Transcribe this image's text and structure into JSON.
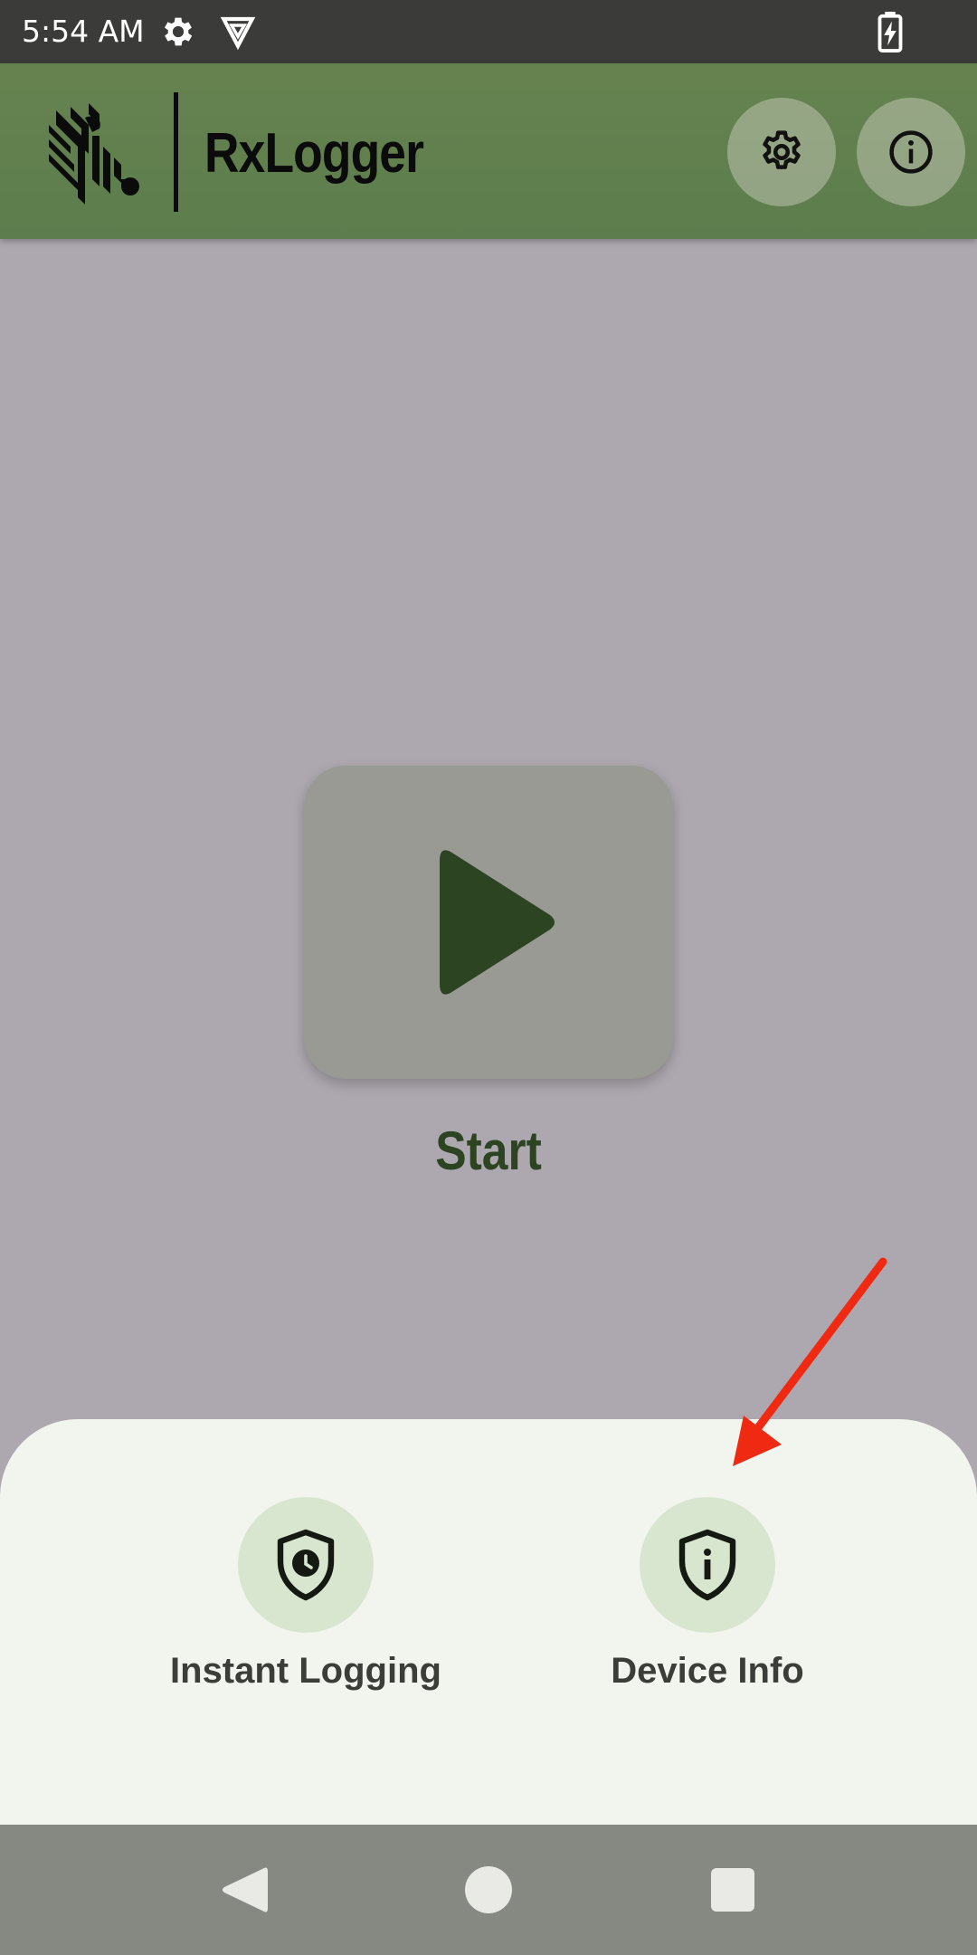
{
  "status_bar": {
    "time": "5:54 AM",
    "icons": [
      "gear-icon",
      "vpn-shield-icon",
      "battery-charging-icon"
    ]
  },
  "app_bar": {
    "title": "RxLogger",
    "logo": "zebra-logo",
    "actions": [
      {
        "name": "settings-button",
        "icon": "gear-icon"
      },
      {
        "name": "info-button",
        "icon": "info-icon"
      }
    ],
    "color": "#5e7e4e"
  },
  "main": {
    "start_label": "Start",
    "start_icon": "play-icon",
    "accent": "#2d4423"
  },
  "bottom_sheet": {
    "actions": [
      {
        "label": "Instant Logging",
        "icon": "shield-clock-icon"
      },
      {
        "label": "Device Info",
        "icon": "shield-info-icon"
      }
    ]
  },
  "annotation": {
    "icon": "red-arrow",
    "color": "#f02a12"
  },
  "nav_bar": {
    "buttons": [
      "back",
      "home",
      "recents"
    ]
  }
}
